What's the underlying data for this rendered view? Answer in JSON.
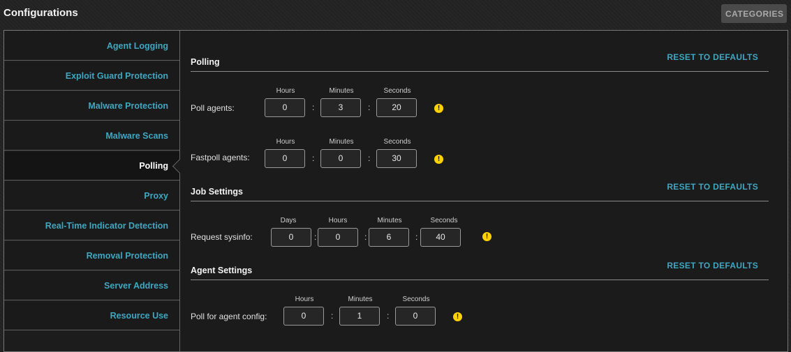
{
  "header": {
    "title": "Configurations",
    "categories_label": "CATEGORIES"
  },
  "sidebar": {
    "items": [
      {
        "label": "Agent Logging"
      },
      {
        "label": "Exploit Guard Protection"
      },
      {
        "label": "Malware Protection"
      },
      {
        "label": "Malware Scans"
      },
      {
        "label": "Polling",
        "active": true
      },
      {
        "label": "Proxy"
      },
      {
        "label": "Real-Time Indicator Detection"
      },
      {
        "label": "Removal Protection"
      },
      {
        "label": "Server Address"
      },
      {
        "label": "Resource Use"
      }
    ]
  },
  "main": {
    "polling": {
      "title": "Polling",
      "reset_label": "RESET TO DEFAULTS",
      "poll_agents": {
        "label": "Poll agents:",
        "hours_label": "Hours",
        "minutes_label": "Minutes",
        "seconds_label": "Seconds",
        "hours": "0",
        "minutes": "3",
        "seconds": "20"
      },
      "fastpoll_agents": {
        "label": "Fastpoll agents:",
        "hours_label": "Hours",
        "minutes_label": "Minutes",
        "seconds_label": "Seconds",
        "hours": "0",
        "minutes": "0",
        "seconds": "30"
      }
    },
    "job_settings": {
      "title": "Job Settings",
      "reset_label": "RESET TO DEFAULTS",
      "request_sysinfo": {
        "label": "Request sysinfo:",
        "days_label": "Days",
        "hours_label": "Hours",
        "minutes_label": "Minutes",
        "seconds_label": "Seconds",
        "days": "0",
        "hours": "0",
        "minutes": "6",
        "seconds": "40"
      }
    },
    "agent_settings": {
      "title": "Agent Settings",
      "reset_label": "RESET TO DEFAULTS",
      "poll_agent_config": {
        "label": "Poll for agent config:",
        "hours_label": "Hours",
        "minutes_label": "Minutes",
        "seconds_label": "Seconds",
        "hours": "0",
        "minutes": "1",
        "seconds": "0"
      }
    },
    "warning_glyph": "!"
  },
  "colors": {
    "accent": "#3ea7c2",
    "warning": "#ffd200",
    "background": "#1b1b1b"
  },
  "icons": {
    "warning": "warning-icon",
    "active_pointer": "chevron-left-icon"
  }
}
